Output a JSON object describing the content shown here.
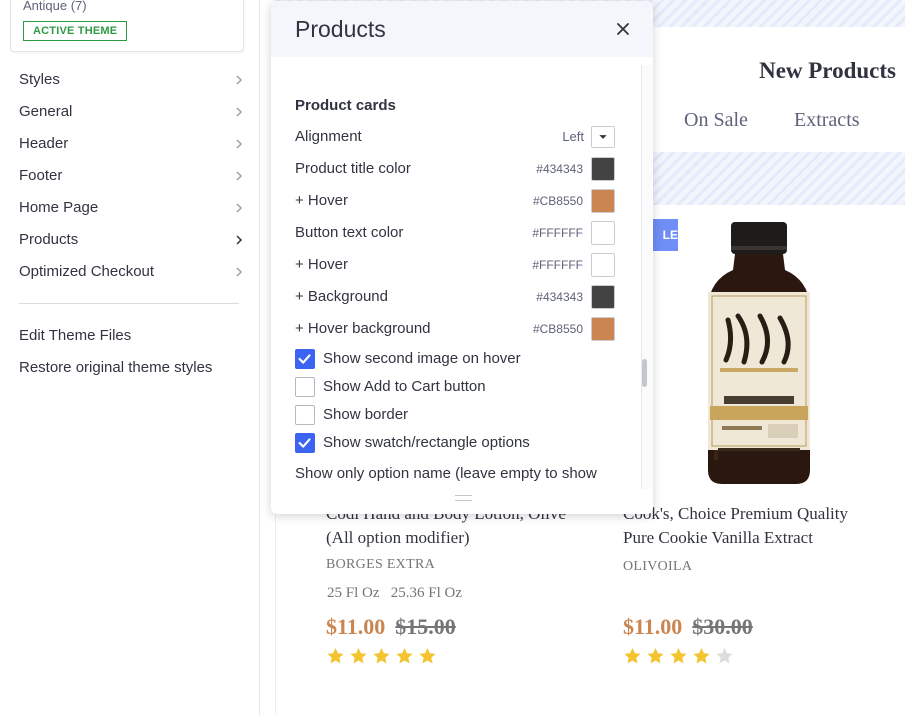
{
  "sidebar": {
    "theme_name": "Antique (7)",
    "active_badge": "ACTIVE THEME",
    "nav_items": [
      {
        "label": "Styles"
      },
      {
        "label": "General"
      },
      {
        "label": "Header"
      },
      {
        "label": "Footer"
      },
      {
        "label": "Home Page"
      },
      {
        "label": "Products",
        "active": true
      },
      {
        "label": "Optimized Checkout"
      }
    ],
    "links": [
      {
        "label": "Edit Theme Files"
      },
      {
        "label": "Restore original theme styles"
      }
    ]
  },
  "preview": {
    "heading": "New Products",
    "tabs": [
      "On Sale",
      "Extracts"
    ],
    "sale_badge": "LE",
    "products": [
      {
        "title_line1": "Codi Hand and Body Lotion, Olive",
        "title_line2": "(All option modifier)",
        "brand": "BORGES EXTRA",
        "sizes": "25 Fl Oz   25.36 Fl Oz",
        "price": "$11.00",
        "was_price": "$15.00",
        "rating": 5
      },
      {
        "title_line1": "Cook's, Choice Premium Quality",
        "title_line2": "Pure Cookie Vanilla Extract",
        "brand": "OLIVOILA",
        "sizes": "",
        "price": "$11.00",
        "was_price": "$30.00",
        "rating": 4
      }
    ],
    "colors": {
      "price": "#CB8550",
      "star": "#F4C430",
      "star_empty": "#DDDDDD"
    }
  },
  "panel": {
    "title": "Products",
    "section": "Product cards",
    "alignment": {
      "label": "Alignment",
      "value": "Left"
    },
    "color_rows": [
      {
        "label": "Product title color",
        "hex": "#434343",
        "color": "#434343"
      },
      {
        "label": "+ Hover",
        "hex": "#CB8550",
        "color": "#CB8550"
      },
      {
        "label": "Button text color",
        "hex": "#FFFFFF",
        "color": "#FFFFFF"
      },
      {
        "label": "+ Hover",
        "hex": "#FFFFFF",
        "color": "#FFFFFF"
      },
      {
        "label": "+ Background",
        "hex": "#434343",
        "color": "#434343"
      },
      {
        "label": "+ Hover background",
        "hex": "#CB8550",
        "color": "#CB8550"
      }
    ],
    "checkboxes": [
      {
        "label": "Show second image on hover",
        "checked": true
      },
      {
        "label": "Show Add to Cart button",
        "checked": false
      },
      {
        "label": "Show border",
        "checked": false
      },
      {
        "label": "Show swatch/rectangle options",
        "checked": true
      }
    ],
    "option_name_label": "Show only option name (leave empty to show"
  }
}
